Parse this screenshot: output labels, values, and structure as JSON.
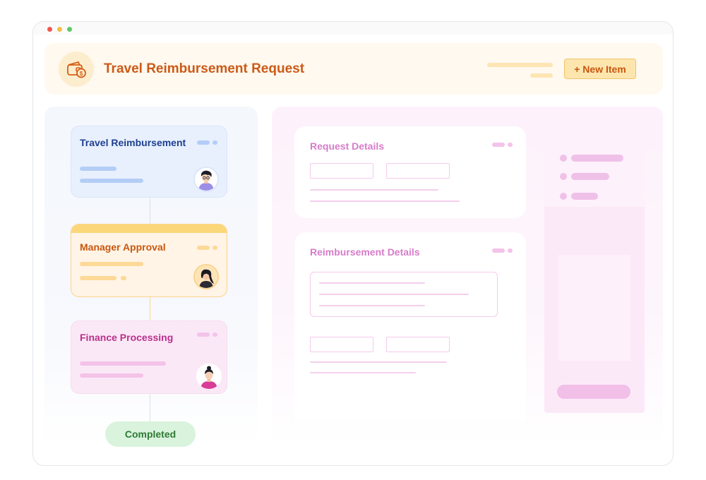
{
  "header": {
    "title": "Travel Reimbursement Request",
    "new_item_label": "+ New Item",
    "icon": "wallet-dollar-icon"
  },
  "workflow": {
    "steps": [
      {
        "label": "Travel Reimbursement",
        "color": "#1d3f8f",
        "avatar": "avatar-man-purple-shirt"
      },
      {
        "label": "Manager Approval",
        "color": "#c8580f",
        "avatar": "avatar-woman-dark-hair"
      },
      {
        "label": "Finance Processing",
        "color": "#b92f8d",
        "avatar": "avatar-woman-pink-top"
      }
    ],
    "completed_label": "Completed",
    "completed_color": "#2e7a34"
  },
  "forms": {
    "request_details_title": "Request Details",
    "reimbursement_details_title": "Reimbursement Details",
    "accent": "#d77cca"
  },
  "colors": {
    "brand_orange": "#cc5a17",
    "blue_card": "#e8f0fe",
    "orange_card": "#fff4e6",
    "pink_card": "#fbe8f6",
    "green_badge": "#d9f3dd"
  }
}
